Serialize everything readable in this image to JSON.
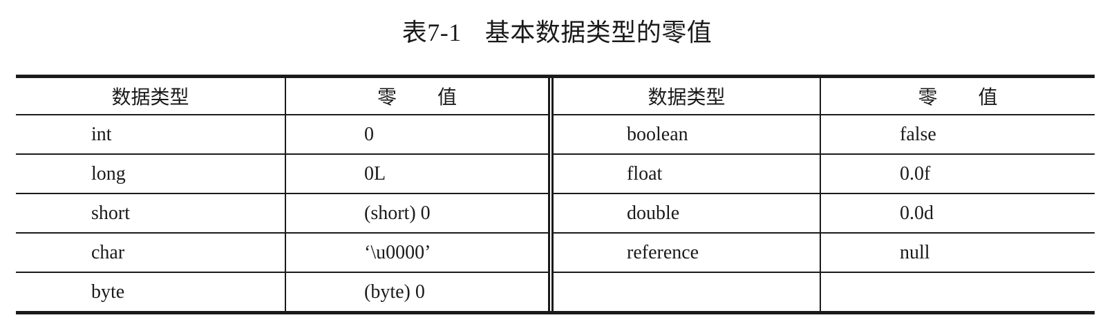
{
  "caption": {
    "number": "表7-1",
    "title": "基本数据类型的零值"
  },
  "table": {
    "headers": [
      "数据类型",
      "零 值",
      "数据类型",
      "零 值"
    ],
    "rows": [
      {
        "type_left": "int",
        "zero_left": "0",
        "type_right": "boolean",
        "zero_right": "false"
      },
      {
        "type_left": "long",
        "zero_left": "0L",
        "type_right": "float",
        "zero_right": "0.0f"
      },
      {
        "type_left": "short",
        "zero_left": "(short) 0",
        "type_right": "double",
        "zero_right": "0.0d"
      },
      {
        "type_left": "char",
        "zero_left": "‘\\u0000’",
        "type_right": "reference",
        "zero_right": "null"
      },
      {
        "type_left": "byte",
        "zero_left": "(byte) 0",
        "type_right": "",
        "zero_right": ""
      }
    ]
  }
}
